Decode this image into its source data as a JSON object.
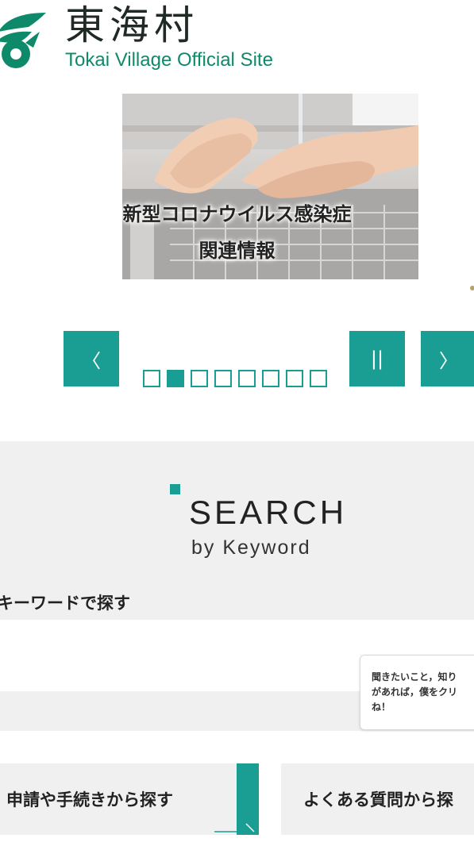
{
  "header": {
    "logo_icon": "tokai-village-emblem",
    "title_ja": "東海村",
    "title_en": "Tokai Village Official Site",
    "brand_color": "#0e8a6a"
  },
  "banner": {
    "line1": "新型コロナウイルス感染症",
    "line2": "関連情報"
  },
  "slider": {
    "prev_icon": "chevron-left-icon",
    "pause_icon": "pause-icon",
    "next_icon": "chevron-right-icon",
    "prev_glyph": "〈",
    "pause_glyph": "||",
    "next_glyph": "〉",
    "slide_count": 8,
    "active_index": 1,
    "accent_color": "#1a9e93"
  },
  "search": {
    "title": "SEARCH",
    "subtitle": "by Keyword",
    "keyword_label": "キーワードで探す",
    "input_placeholder": "",
    "bubble_text": "聞きたいこと，知り\nがあれば，僕をクリ\nね！"
  },
  "nav": {
    "apply_label": "申請や手続きから探す",
    "faq_label": "よくある質問から探"
  }
}
